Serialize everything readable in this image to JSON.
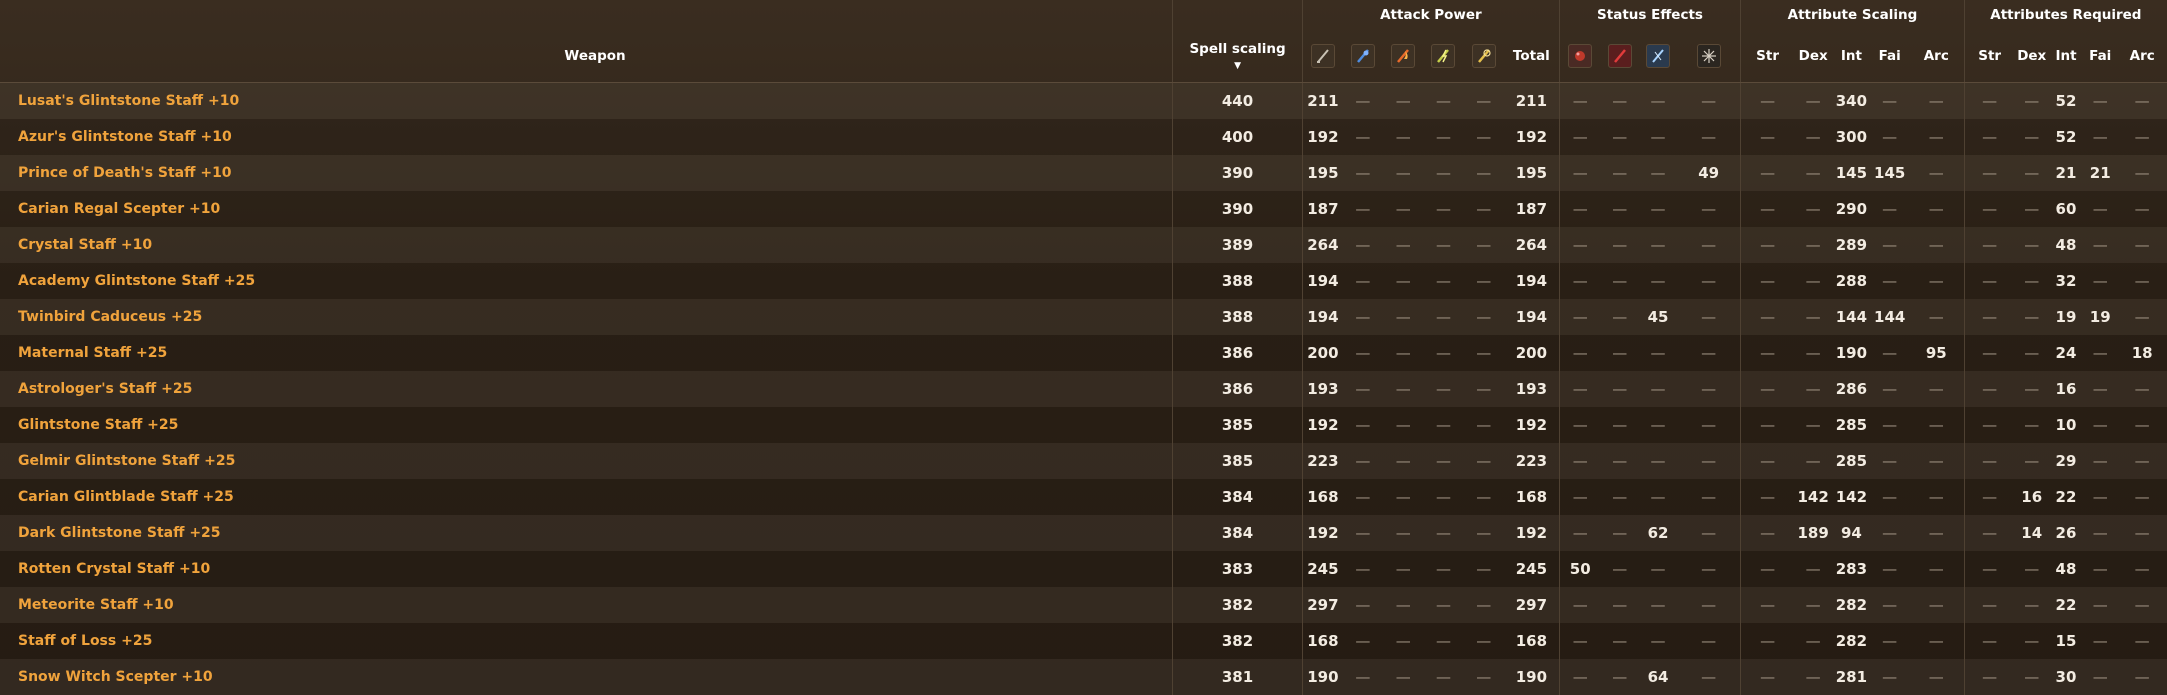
{
  "groups": {
    "attack_power": "Attack Power",
    "status_effects": "Status Effects",
    "attribute_scaling": "Attribute Scaling",
    "attributes_required": "Attributes Required"
  },
  "columns": {
    "weapon": "Weapon",
    "spell_scaling": "Spell scaling",
    "total": "Total",
    "attack_icons": [
      "physical-damage-icon",
      "magic-damage-icon",
      "fire-damage-icon",
      "lightning-damage-icon",
      "holy-damage-icon"
    ],
    "status_icons": [
      "bleed-icon",
      "hemorrhage-icon",
      "frostbite-icon",
      "sleep-icon"
    ],
    "scaling": [
      "Str",
      "Dex",
      "Int",
      "Fai",
      "Arc"
    ],
    "required": [
      "Str",
      "Dex",
      "Int",
      "Fai",
      "Arc"
    ]
  },
  "dash": "—",
  "rows": [
    {
      "weapon": "Lusat's Glintstone Staff +10",
      "spell": "440",
      "ap": [
        "211",
        "—",
        "—",
        "—",
        "—"
      ],
      "total": "211",
      "status": [
        "—",
        "—",
        "—",
        "—"
      ],
      "scaling": [
        "—",
        "—",
        "340",
        "—",
        "—"
      ],
      "req": [
        "—",
        "—",
        "52",
        "—",
        "—"
      ]
    },
    {
      "weapon": "Azur's Glintstone Staff +10",
      "spell": "400",
      "ap": [
        "192",
        "—",
        "—",
        "—",
        "—"
      ],
      "total": "192",
      "status": [
        "—",
        "—",
        "—",
        "—"
      ],
      "scaling": [
        "—",
        "—",
        "300",
        "—",
        "—"
      ],
      "req": [
        "—",
        "—",
        "52",
        "—",
        "—"
      ]
    },
    {
      "weapon": "Prince of Death's Staff +10",
      "spell": "390",
      "ap": [
        "195",
        "—",
        "—",
        "—",
        "—"
      ],
      "total": "195",
      "status": [
        "—",
        "—",
        "—",
        "49"
      ],
      "scaling": [
        "—",
        "—",
        "145",
        "145",
        "—"
      ],
      "req": [
        "—",
        "—",
        "21",
        "21",
        "—"
      ]
    },
    {
      "weapon": "Carian Regal Scepter +10",
      "spell": "390",
      "ap": [
        "187",
        "—",
        "—",
        "—",
        "—"
      ],
      "total": "187",
      "status": [
        "—",
        "—",
        "—",
        "—"
      ],
      "scaling": [
        "—",
        "—",
        "290",
        "—",
        "—"
      ],
      "req": [
        "—",
        "—",
        "60",
        "—",
        "—"
      ]
    },
    {
      "weapon": "Crystal Staff +10",
      "spell": "389",
      "ap": [
        "264",
        "—",
        "—",
        "—",
        "—"
      ],
      "total": "264",
      "status": [
        "—",
        "—",
        "—",
        "—"
      ],
      "scaling": [
        "—",
        "—",
        "289",
        "—",
        "—"
      ],
      "req": [
        "—",
        "—",
        "48",
        "—",
        "—"
      ]
    },
    {
      "weapon": "Academy Glintstone Staff +25",
      "spell": "388",
      "ap": [
        "194",
        "—",
        "—",
        "—",
        "—"
      ],
      "total": "194",
      "status": [
        "—",
        "—",
        "—",
        "—"
      ],
      "scaling": [
        "—",
        "—",
        "288",
        "—",
        "—"
      ],
      "req": [
        "—",
        "—",
        "32",
        "—",
        "—"
      ]
    },
    {
      "weapon": "Twinbird Caduceus +25",
      "spell": "388",
      "ap": [
        "194",
        "—",
        "—",
        "—",
        "—"
      ],
      "total": "194",
      "status": [
        "—",
        "—",
        "45",
        "—"
      ],
      "scaling": [
        "—",
        "—",
        "144",
        "144",
        "—"
      ],
      "req": [
        "—",
        "—",
        "19",
        "19",
        "—"
      ]
    },
    {
      "weapon": "Maternal Staff +25",
      "spell": "386",
      "ap": [
        "200",
        "—",
        "—",
        "—",
        "—"
      ],
      "total": "200",
      "status": [
        "—",
        "—",
        "—",
        "—"
      ],
      "scaling": [
        "—",
        "—",
        "190",
        "—",
        "95"
      ],
      "req": [
        "—",
        "—",
        "24",
        "—",
        "18"
      ]
    },
    {
      "weapon": "Astrologer's Staff +25",
      "spell": "386",
      "ap": [
        "193",
        "—",
        "—",
        "—",
        "—"
      ],
      "total": "193",
      "status": [
        "—",
        "—",
        "—",
        "—"
      ],
      "scaling": [
        "—",
        "—",
        "286",
        "—",
        "—"
      ],
      "req": [
        "—",
        "—",
        "16",
        "—",
        "—"
      ]
    },
    {
      "weapon": "Glintstone Staff +25",
      "spell": "385",
      "ap": [
        "192",
        "—",
        "—",
        "—",
        "—"
      ],
      "total": "192",
      "status": [
        "—",
        "—",
        "—",
        "—"
      ],
      "scaling": [
        "—",
        "—",
        "285",
        "—",
        "—"
      ],
      "req": [
        "—",
        "—",
        "10",
        "—",
        "—"
      ]
    },
    {
      "weapon": "Gelmir Glintstone Staff +25",
      "spell": "385",
      "ap": [
        "223",
        "—",
        "—",
        "—",
        "—"
      ],
      "total": "223",
      "status": [
        "—",
        "—",
        "—",
        "—"
      ],
      "scaling": [
        "—",
        "—",
        "285",
        "—",
        "—"
      ],
      "req": [
        "—",
        "—",
        "29",
        "—",
        "—"
      ]
    },
    {
      "weapon": "Carian Glintblade Staff +25",
      "spell": "384",
      "ap": [
        "168",
        "—",
        "—",
        "—",
        "—"
      ],
      "total": "168",
      "status": [
        "—",
        "—",
        "—",
        "—"
      ],
      "scaling": [
        "—",
        "142",
        "142",
        "—",
        "—"
      ],
      "req": [
        "—",
        "16",
        "22",
        "—",
        "—"
      ]
    },
    {
      "weapon": "Dark Glintstone Staff +25",
      "spell": "384",
      "ap": [
        "192",
        "—",
        "—",
        "—",
        "—"
      ],
      "total": "192",
      "status": [
        "—",
        "—",
        "62",
        "—"
      ],
      "scaling": [
        "—",
        "189",
        "94",
        "—",
        "—"
      ],
      "req": [
        "—",
        "14",
        "26",
        "—",
        "—"
      ]
    },
    {
      "weapon": "Rotten Crystal Staff +10",
      "spell": "383",
      "ap": [
        "245",
        "—",
        "—",
        "—",
        "—"
      ],
      "total": "245",
      "status": [
        "50",
        "—",
        "—",
        "—"
      ],
      "scaling": [
        "—",
        "—",
        "283",
        "—",
        "—"
      ],
      "req": [
        "—",
        "—",
        "48",
        "—",
        "—"
      ]
    },
    {
      "weapon": "Meteorite Staff +10",
      "spell": "382",
      "ap": [
        "297",
        "—",
        "—",
        "—",
        "—"
      ],
      "total": "297",
      "status": [
        "—",
        "—",
        "—",
        "—"
      ],
      "scaling": [
        "—",
        "—",
        "282",
        "—",
        "—"
      ],
      "req": [
        "—",
        "—",
        "22",
        "—",
        "—"
      ]
    },
    {
      "weapon": "Staff of Loss +25",
      "spell": "382",
      "ap": [
        "168",
        "—",
        "—",
        "—",
        "—"
      ],
      "total": "168",
      "status": [
        "—",
        "—",
        "—",
        "—"
      ],
      "scaling": [
        "—",
        "—",
        "282",
        "—",
        "—"
      ],
      "req": [
        "—",
        "—",
        "15",
        "—",
        "—"
      ]
    },
    {
      "weapon": "Snow Witch Scepter +10",
      "spell": "381",
      "ap": [
        "190",
        "—",
        "—",
        "—",
        "—"
      ],
      "total": "190",
      "status": [
        "—",
        "—",
        "64",
        "—"
      ],
      "scaling": [
        "—",
        "—",
        "281",
        "—",
        "—"
      ],
      "req": [
        "—",
        "—",
        "30",
        "—",
        "—"
      ]
    }
  ]
}
